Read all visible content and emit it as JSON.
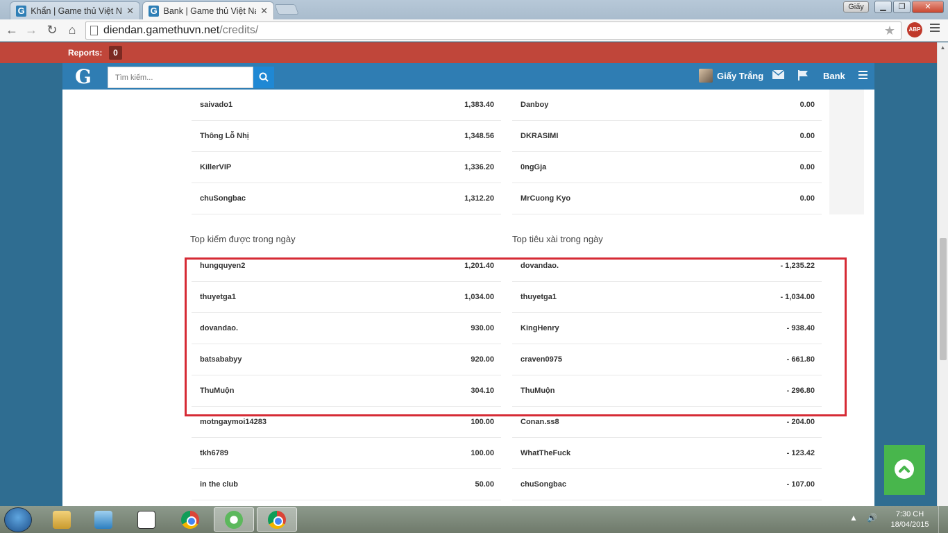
{
  "browser": {
    "tabs": [
      {
        "title": "Khẩn | Game thủ Việt Nam",
        "active": false
      },
      {
        "title": "Bank | Game thủ Việt Nam",
        "active": true
      }
    ],
    "user_chip": "Giấy",
    "url_host": "diendan.gamethuvn.net",
    "url_path": "/credits/",
    "abp_label": "ABP"
  },
  "reports": {
    "label": "Reports:",
    "count": "0"
  },
  "header": {
    "logo": "G",
    "search_placeholder": "Tìm kiếm...",
    "username": "Giấy Trắng",
    "bank_label": "Bank"
  },
  "top_rows": {
    "left": [
      {
        "name": "saivado1",
        "value": "1,383.40"
      },
      {
        "name": "Thông Lỗ Nhị",
        "value": "1,348.56"
      },
      {
        "name": "KillerVIP",
        "value": "1,336.20"
      },
      {
        "name": "chuSongbac",
        "value": "1,312.20"
      }
    ],
    "right": [
      {
        "name": "Danboy",
        "value": "0.00"
      },
      {
        "name": "DKRASIMI",
        "value": "0.00"
      },
      {
        "name": "0ngGja",
        "value": "0.00"
      },
      {
        "name": "MrCuong Kyo",
        "value": "0.00"
      }
    ]
  },
  "daily": {
    "earned_title": "Top kiếm được trong ngày",
    "spent_title": "Top tiêu xài trong ngày",
    "earned": [
      {
        "name": "hungquyen2",
        "value": "1,201.40"
      },
      {
        "name": "thuyetga1",
        "value": "1,034.00"
      },
      {
        "name": "dovandao.",
        "value": "930.00"
      },
      {
        "name": "batsababyy",
        "value": "920.00"
      },
      {
        "name": "ThuMuộn",
        "value": "304.10"
      },
      {
        "name": "motngaymoi14283",
        "value": "100.00"
      },
      {
        "name": "tkh6789",
        "value": "100.00"
      },
      {
        "name": "in the club",
        "value": "50.00"
      }
    ],
    "spent": [
      {
        "name": "dovandao.",
        "value": "- 1,235.22"
      },
      {
        "name": "thuyetga1",
        "value": "- 1,034.00"
      },
      {
        "name": "KingHenry",
        "value": "- 938.40"
      },
      {
        "name": "craven0975",
        "value": "- 661.80"
      },
      {
        "name": "ThuMuộn",
        "value": "- 296.80"
      },
      {
        "name": "Conan.ss8",
        "value": "- 204.00"
      },
      {
        "name": "WhatTheFuck",
        "value": "- 123.42"
      },
      {
        "name": "chuSongbac",
        "value": "- 107.00"
      }
    ]
  },
  "taskbar": {
    "time": "7:30 CH",
    "date": "18/04/2015"
  },
  "colors": {
    "reports_bar": "#c0463a",
    "header": "#2f7db3",
    "highlight": "#d62b35",
    "to_top": "#48b64c"
  }
}
